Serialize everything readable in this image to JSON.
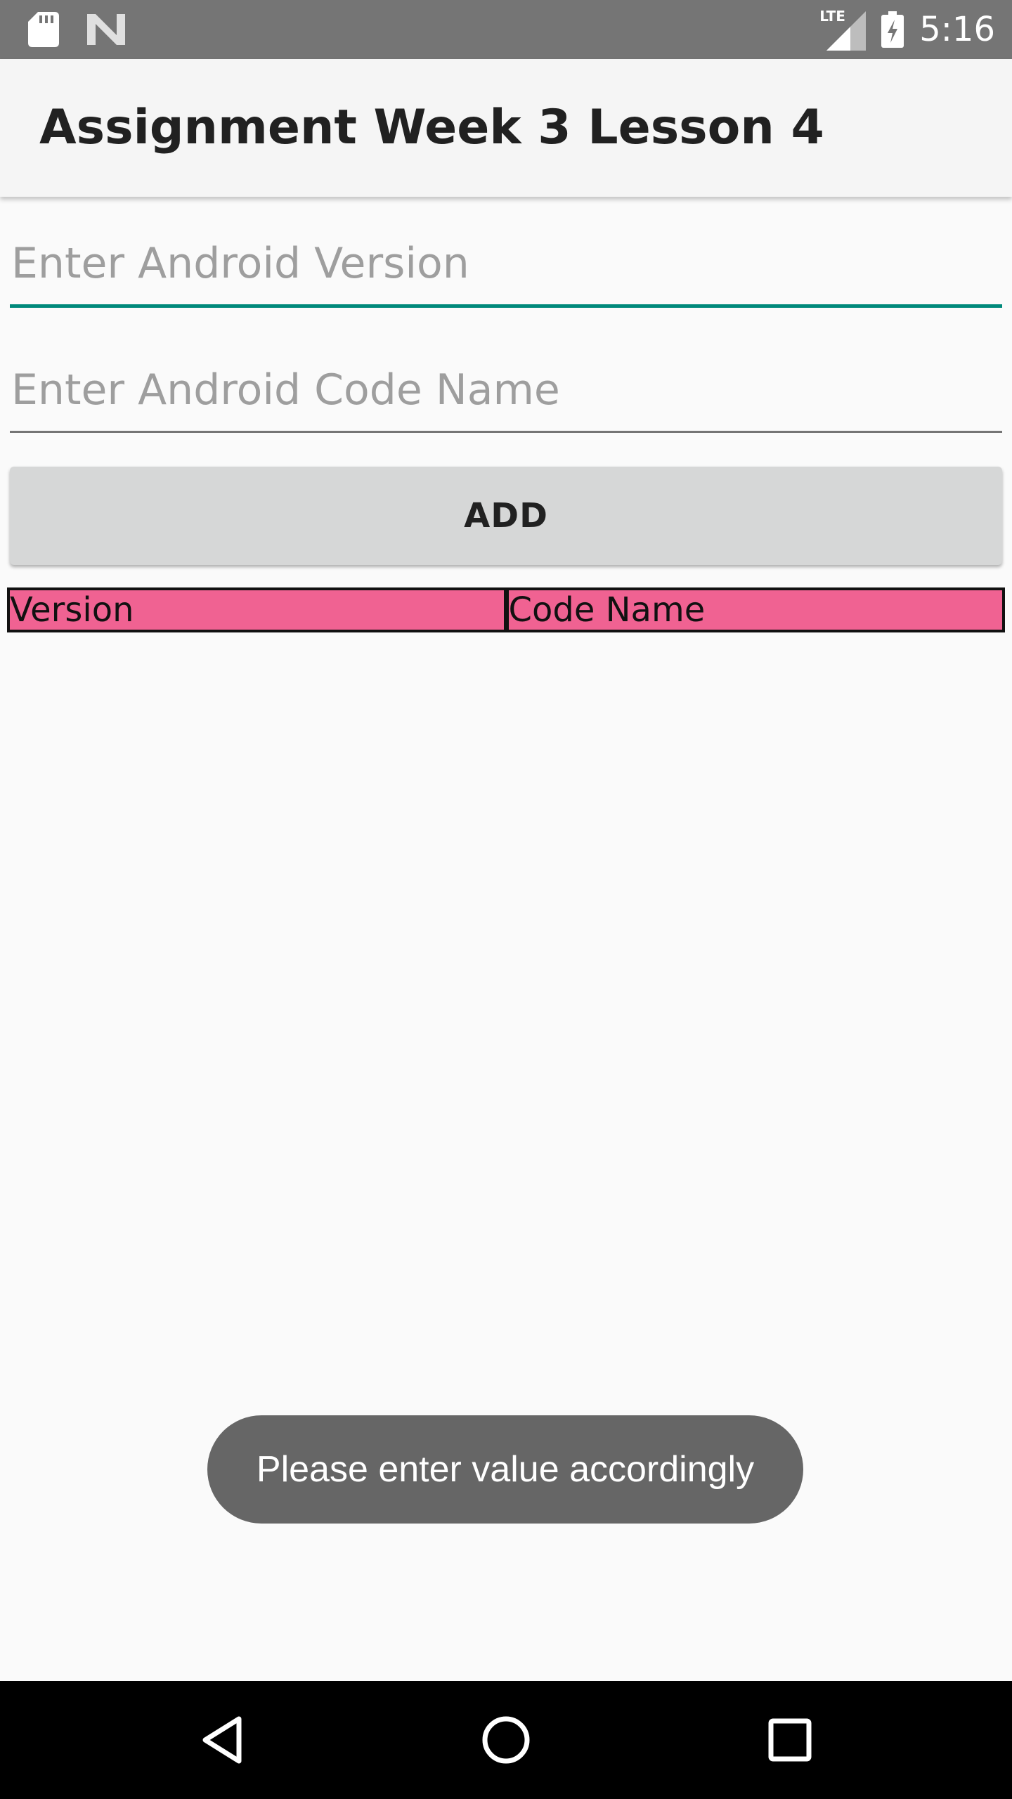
{
  "status_bar": {
    "time": "5:16",
    "network_label": "LTE",
    "icons": [
      "sd-card-icon",
      "android-n-icon",
      "lte-signal-icon",
      "battery-charging-icon"
    ]
  },
  "app_bar": {
    "title": "Assignment Week 3 Lesson 4"
  },
  "form": {
    "version_field": {
      "value": "",
      "placeholder": "Enter Android Version"
    },
    "codename_field": {
      "value": "",
      "placeholder": "Enter Android Code Name"
    },
    "add_label": "ADD"
  },
  "table": {
    "headers": [
      "Version",
      "Code Name"
    ],
    "rows": []
  },
  "toast": {
    "message": "Please enter value accordingly"
  },
  "nav_bar": {
    "icons": [
      "back-icon",
      "home-icon",
      "recents-icon"
    ]
  },
  "colors": {
    "status_bar": "#757575",
    "app_bar": "#f5f5f5",
    "accent": "#00897b",
    "table_header": "#f06292",
    "button": "#d6d7d7",
    "toast": "#666666",
    "nav_bar": "#000000"
  }
}
